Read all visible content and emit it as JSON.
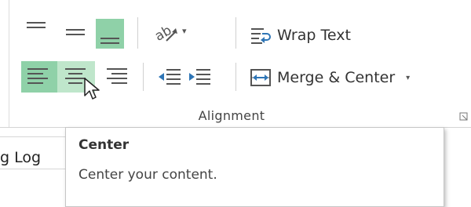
{
  "ribbon": {
    "group_label": "Alignment",
    "wrap_text_label": "Wrap Text",
    "merge_center_label": "Merge & Center",
    "orientation_arrow": "▾",
    "merge_arrow": "▾"
  },
  "tooltip": {
    "title": "Center",
    "description": "Center your content."
  },
  "sheet": {
    "cell_text": "g Log"
  },
  "colors": {
    "active_bg": "#8fd1a8",
    "hover_bg": "#bfe6cb",
    "indent_blue": "#2e75b6"
  }
}
